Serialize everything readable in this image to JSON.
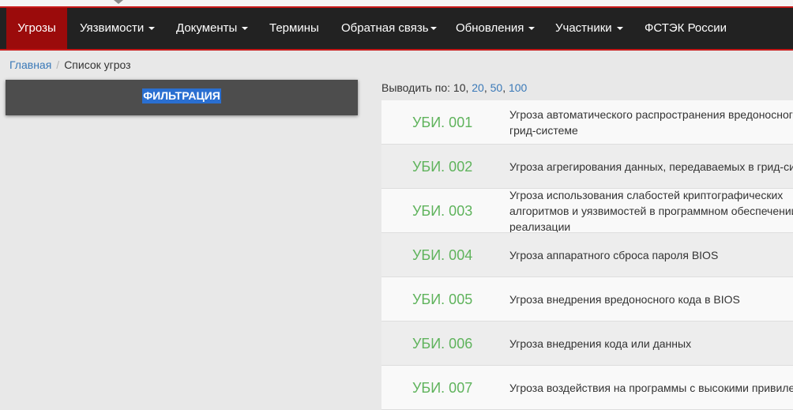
{
  "nav": {
    "items": [
      {
        "label": "Угрозы",
        "active": true,
        "dropdown": false
      },
      {
        "label": "Уязвимости",
        "active": false,
        "dropdown": true
      },
      {
        "label": "Документы",
        "active": false,
        "dropdown": true
      },
      {
        "label": "Термины",
        "active": false,
        "dropdown": false
      },
      {
        "label": "Обратная связь",
        "active": false,
        "dropdown": true
      },
      {
        "label": "Обновления",
        "active": false,
        "dropdown": true
      },
      {
        "label": "Участники",
        "active": false,
        "dropdown": true
      },
      {
        "label": "ФСТЭК России",
        "active": false,
        "dropdown": false
      }
    ]
  },
  "breadcrumb": {
    "home": "Главная",
    "separator": "/",
    "current": "Список угроз"
  },
  "filter": {
    "label": "ФИЛЬТРАЦИЯ"
  },
  "perpage": {
    "prefix": "Выводить по:",
    "current": "10",
    "options": [
      "20",
      "50",
      "100"
    ]
  },
  "threats": [
    {
      "id": "УБИ. 001",
      "title": "Угроза автоматического распространения вредоносного кода в грид-системе"
    },
    {
      "id": "УБИ. 002",
      "title": "Угроза агрегирования данных, передаваемых в грид-системе"
    },
    {
      "id": "УБИ. 003",
      "title": "Угроза использования слабостей криптографических алгоритмов и уязвимостей в программном обеспечении их реализации"
    },
    {
      "id": "УБИ. 004",
      "title": "Угроза аппаратного сброса пароля BIOS"
    },
    {
      "id": "УБИ. 005",
      "title": "Угроза внедрения вредоносного кода в BIOS"
    },
    {
      "id": "УБИ. 006",
      "title": "Угроза внедрения кода или данных"
    },
    {
      "id": "УБИ. 007",
      "title": "Угроза воздействия на программы с высокими привилегиями"
    }
  ],
  "colors": {
    "navbar_bg": "#222222",
    "navbar_border": "#c81818",
    "active_tab": "#9b0b0b",
    "link": "#3a79b8",
    "threat_id": "#5fb35c",
    "filter_bg": "#4d4d4d",
    "selection": "#2a6fd1"
  }
}
